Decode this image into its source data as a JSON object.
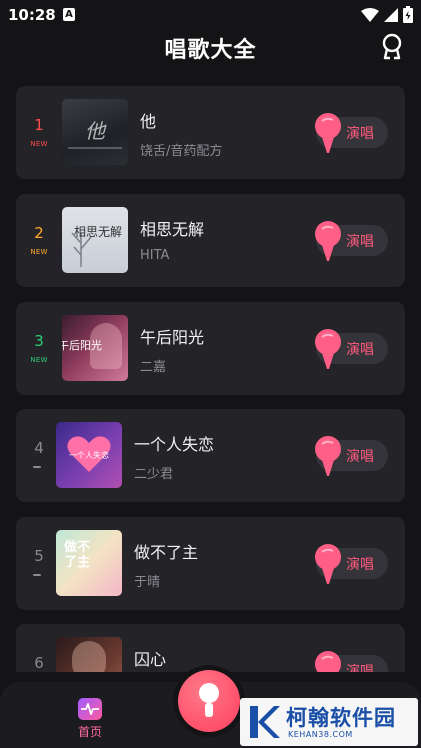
{
  "status_bar": {
    "time": "10:28",
    "badge": "A"
  },
  "header": {
    "title": "唱歌大全",
    "profile_icon": "person-outline-icon"
  },
  "colors": {
    "accent": "#ff5a7e",
    "rank_1": "#ff4a4a",
    "rank_2": "#ffaa2a",
    "rank_3": "#2ecf78",
    "rank_other": "#8a8a90",
    "card": "#232328",
    "background": "#141416"
  },
  "songs": [
    {
      "rank": "1",
      "badge": "NEW",
      "title": "他",
      "artist": "饶舌/音药配方",
      "cover_text": "他",
      "cover_icon": "album-cover-dark-grey"
    },
    {
      "rank": "2",
      "badge": "NEW",
      "title": "相思无解",
      "artist": "HITA",
      "cover_text": "相思无解",
      "cover_icon": "album-cover-snow-tree"
    },
    {
      "rank": "3",
      "badge": "NEW",
      "title": "午后阳光",
      "artist": "二嘉",
      "cover_text": "午后阳光",
      "cover_icon": "album-cover-portrait-pink"
    },
    {
      "rank": "4",
      "badge": "",
      "title": "一个人失恋",
      "artist": "二少君",
      "cover_text": "一个人失恋",
      "cover_icon": "album-cover-heart"
    },
    {
      "rank": "5",
      "badge": "",
      "title": "做不了主",
      "artist": "于晴",
      "cover_text": "做不了主",
      "cover_icon": "album-cover-pastel"
    },
    {
      "rank": "6",
      "badge": "",
      "title": "囚心",
      "artist": "",
      "cover_text": "",
      "cover_icon": "album-cover-portrait-dark"
    }
  ],
  "sing_button_label": "演唱",
  "tab_bar": {
    "home_label": "首页",
    "home_icon": "pulse-wave-icon",
    "center_icon": "microphone-icon"
  },
  "watermark": {
    "name": "柯翰软件园",
    "url": "KEHAN38.COM"
  }
}
